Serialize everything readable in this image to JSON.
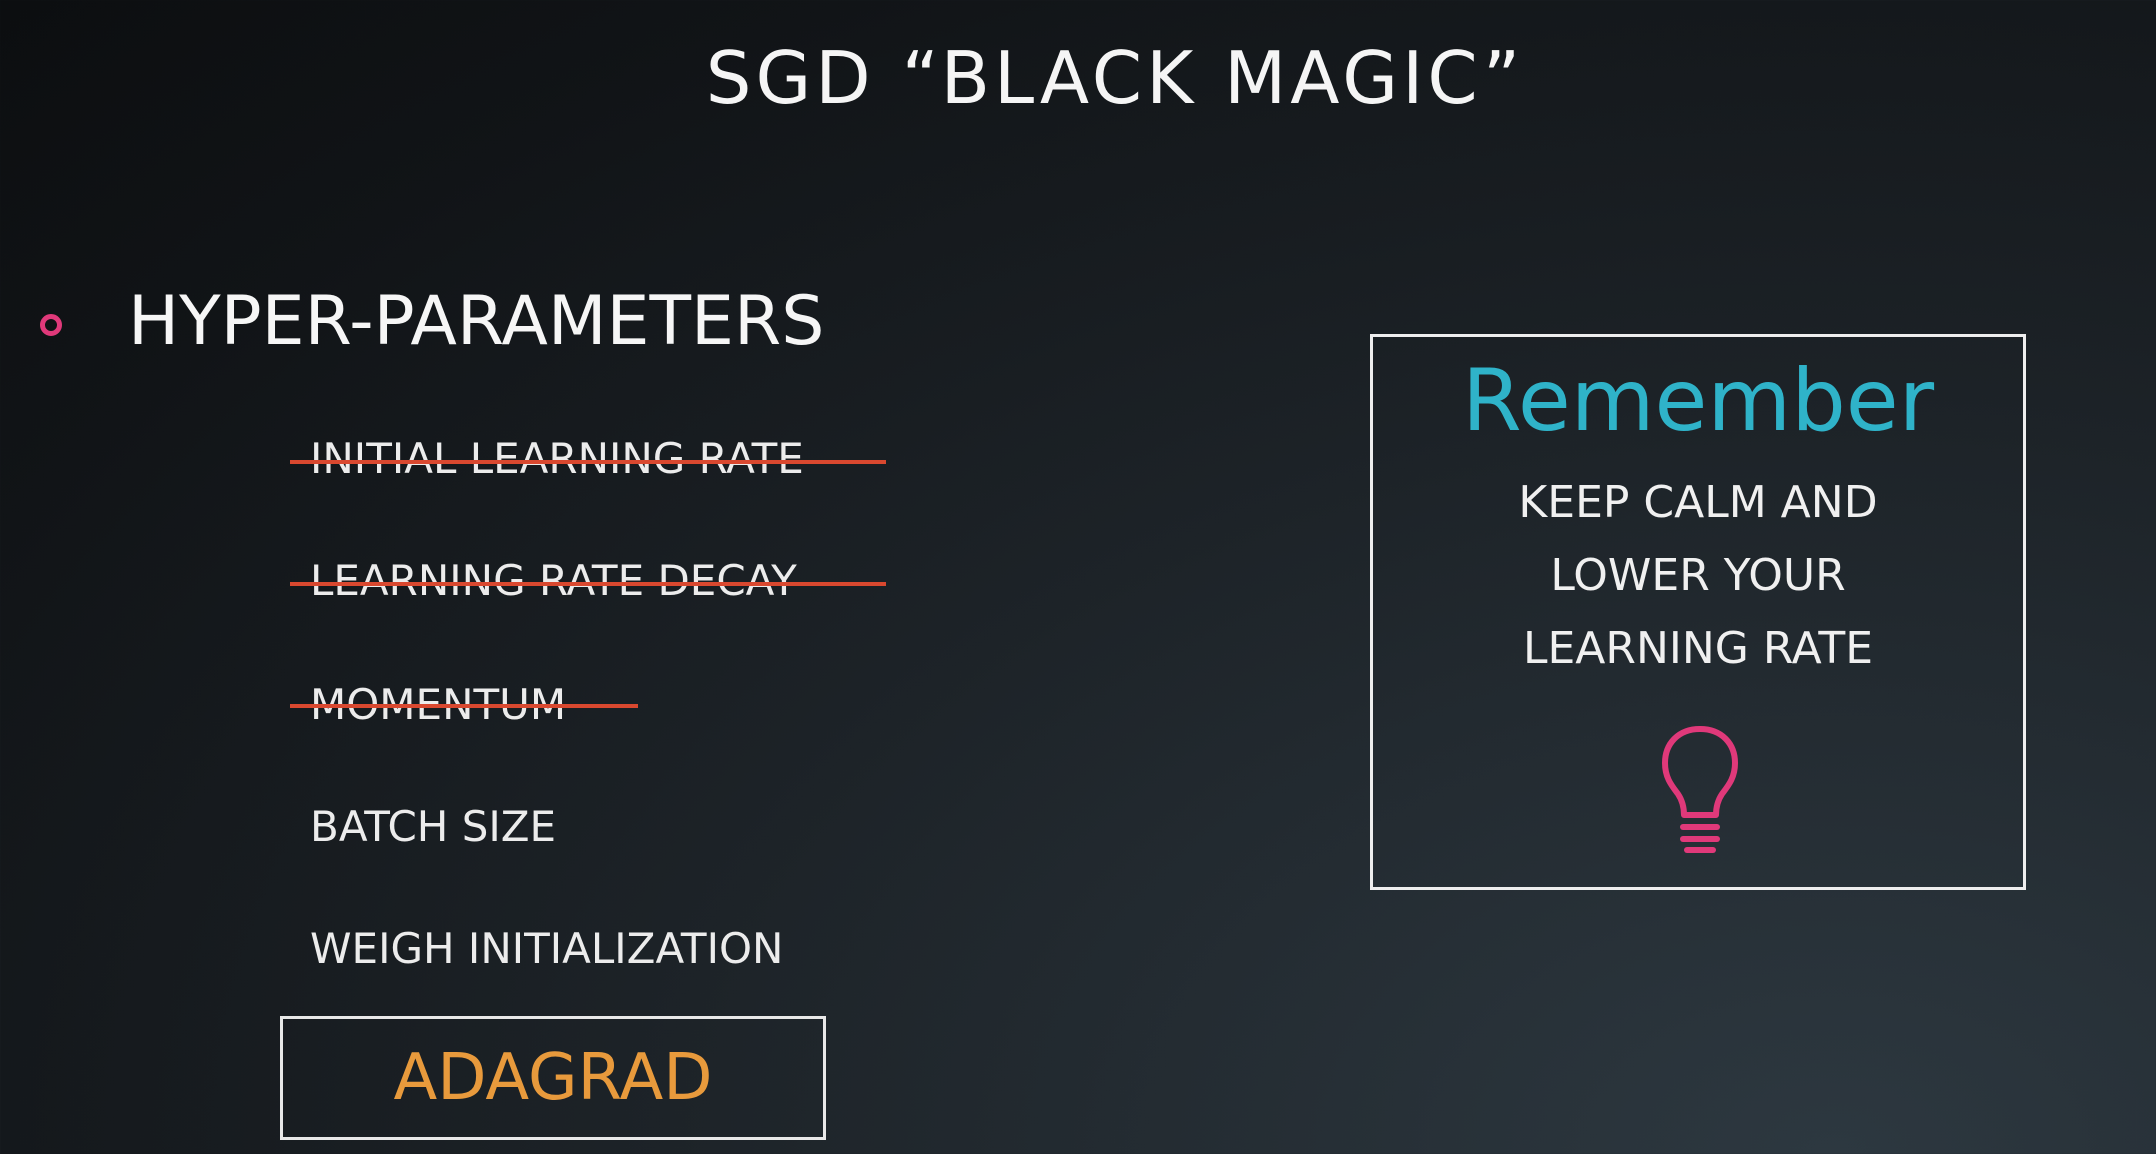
{
  "slide": {
    "title": "SGD “BLACK MAGIC”"
  },
  "hyperparameters": {
    "heading": "HYPER-PARAMETERS",
    "items": [
      {
        "label": "INITIAL LEARNING RATE",
        "struck": true
      },
      {
        "label": "LEARNING RATE DECAY",
        "struck": true
      },
      {
        "label": "MOMENTUM",
        "struck": true
      },
      {
        "label": "BATCH SIZE",
        "struck": false
      },
      {
        "label": "WEIGH INITIALIZATION",
        "struck": false
      }
    ],
    "highlight": "ADAGRAD"
  },
  "remember": {
    "title": "Remember",
    "lines": [
      "KEEP CALM AND",
      "LOWER YOUR",
      "LEARNING RATE"
    ],
    "icon": "lightbulb-icon"
  },
  "colors": {
    "bullet": "#e0397a",
    "strikethrough": "#d9482f",
    "highlight_text": "#e89a3c",
    "remember_title": "#2fb3c9",
    "lightbulb": "#e0397a"
  }
}
